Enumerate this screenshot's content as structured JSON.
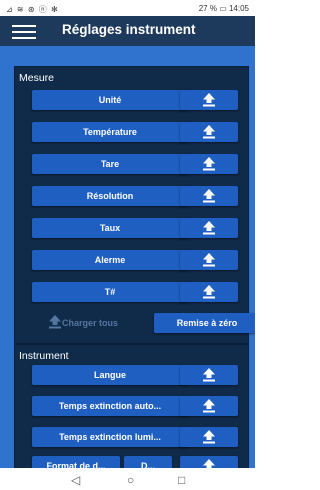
{
  "status": {
    "left": "⊿ ≋ ⊛ ⓝ ✻",
    "right": "27 % ▭ 14:05"
  },
  "header": {
    "title": "Réglages instrument"
  },
  "mesure": {
    "title": "Mesure",
    "items": [
      {
        "label": "Unité"
      },
      {
        "label": "Température"
      },
      {
        "label": "Tare"
      },
      {
        "label": "Résolution"
      },
      {
        "label": "Taux"
      },
      {
        "label": "Alerme"
      },
      {
        "label": "T#"
      }
    ],
    "charger_label": "Charger tous",
    "reset_label": "Remise à zéro"
  },
  "instrument": {
    "title": "Instrument",
    "items": [
      {
        "label": "Langue"
      },
      {
        "label": "Temps extinction auto..."
      },
      {
        "label": "Temps extinction lumi..."
      }
    ],
    "format_label": "Format de d...",
    "format2_label": "D..."
  },
  "nav": {
    "back": "◁",
    "home": "○",
    "recent": "□"
  },
  "colors": {
    "appbar": "#1d3a5c",
    "background": "#2f73ce",
    "panel": "#102a4a",
    "button": "#1f5fc2",
    "disabled_text": "#55769e"
  }
}
